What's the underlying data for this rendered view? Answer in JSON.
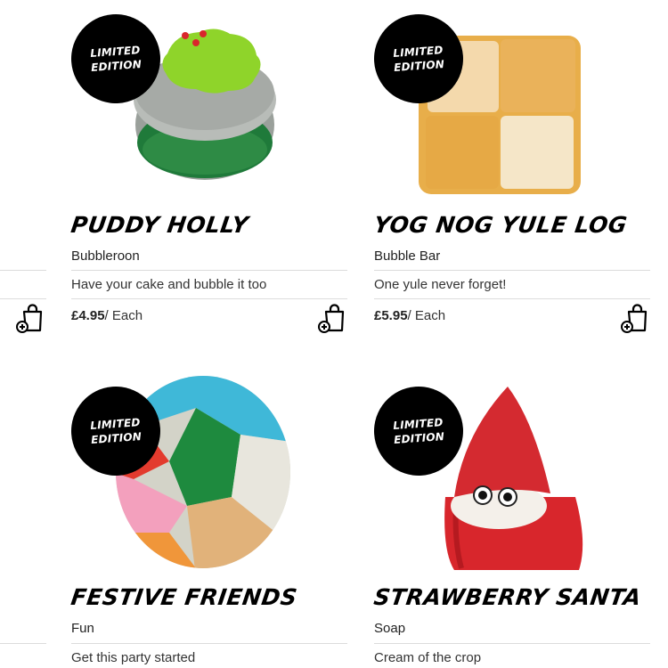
{
  "products": [
    {
      "badge_line1": "LIMITED",
      "badge_line2": "EDITION",
      "name": "PUDDY HOLLY",
      "category": "Bubbleroon",
      "tagline": "Have your cake and bubble it too",
      "price": "£4.95",
      "unit": "/ Each",
      "image_icon": "bubbleroon-product-image"
    },
    {
      "badge_line1": "LIMITED",
      "badge_line2": "EDITION",
      "name": "YOG NOG YULE LOG",
      "category": "Bubble Bar",
      "tagline": "One yule never forget!",
      "price": "£5.95",
      "unit": "/ Each",
      "image_icon": "bubble-bar-product-image"
    },
    {
      "badge_line1": "LIMITED",
      "badge_line2": "EDITION",
      "name": "FESTIVE FRIENDS",
      "category": "Fun",
      "tagline": "Get this party started",
      "image_icon": "fun-product-image"
    },
    {
      "badge_line1": "LIMITED",
      "badge_line2": "EDITION",
      "name": "STRAWBERRY SANTA",
      "category": "Soap",
      "tagline": "Cream of the crop",
      "image_icon": "soap-product-image"
    }
  ],
  "icons": {
    "add_to_basket": "add-to-basket-icon"
  },
  "colors": {
    "badge_bg": "#000000",
    "badge_text": "#ffffff",
    "divider": "#dcdcdc"
  }
}
